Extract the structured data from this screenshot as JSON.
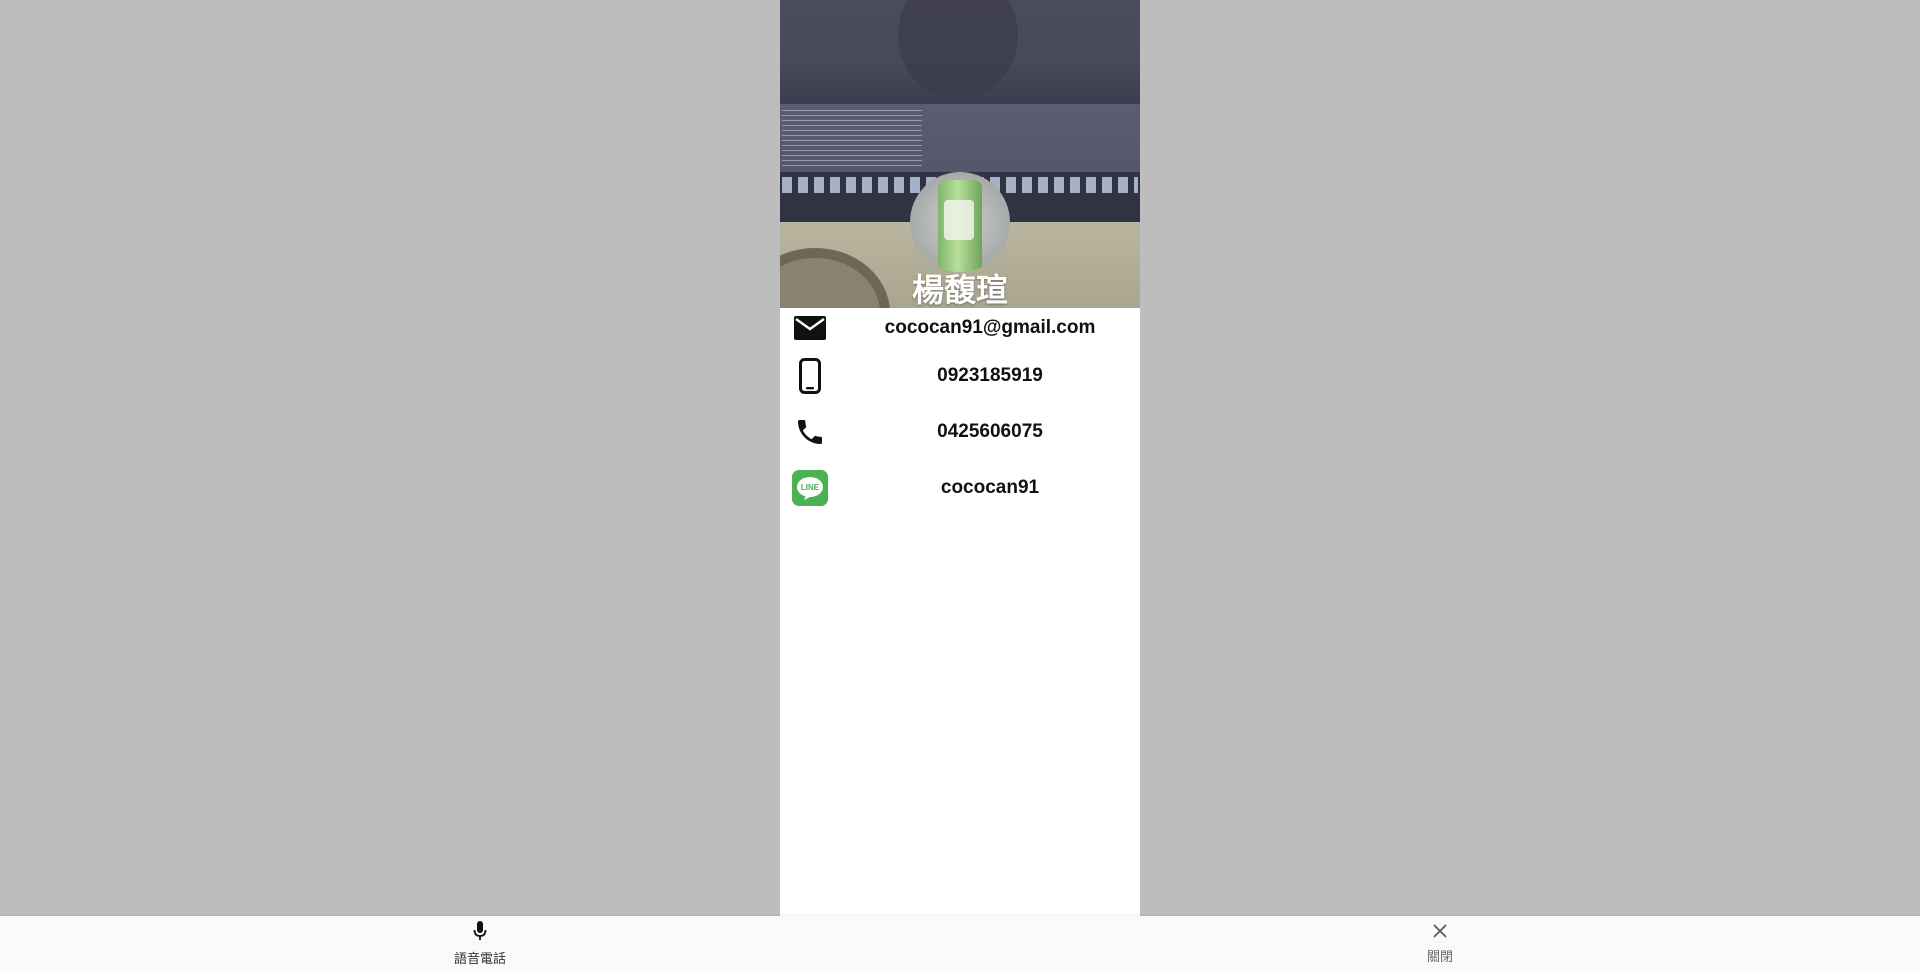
{
  "profile": {
    "name": "楊馥瑄",
    "background_desc": "photo-banner",
    "avatar_desc": "avatar-photo"
  },
  "contacts": [
    {
      "icon": "mail-icon",
      "value": "cococan91@gmail.com"
    },
    {
      "icon": "mobile-phone-icon",
      "value": "0923185919"
    },
    {
      "icon": "phone-icon",
      "value": "0425606075"
    },
    {
      "icon": "line-icon",
      "value": "cococan91",
      "icon_text": "LINE",
      "icon_color": "#4cb152"
    }
  ],
  "bottom_bar": {
    "voice_call_label": "語音電話",
    "close_label": "關閉"
  },
  "colors": {
    "page_background": "#bdbdbd",
    "card_background": "#ffffff",
    "line_green": "#4cb152"
  }
}
